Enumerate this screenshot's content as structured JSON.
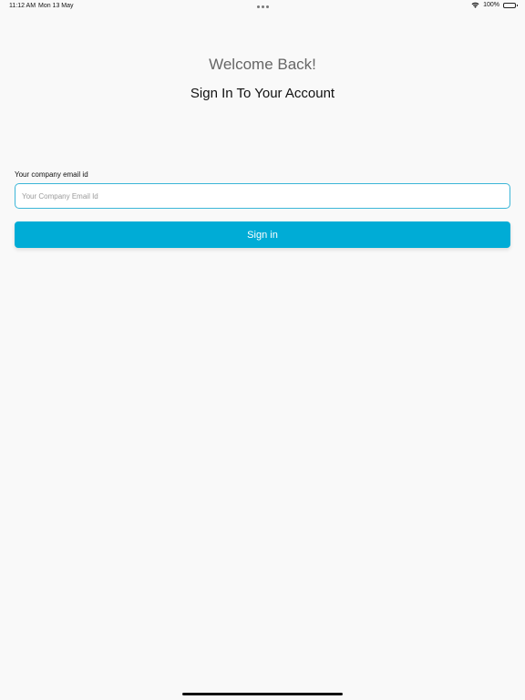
{
  "status_bar": {
    "time": "11:12 AM",
    "date": "Mon 13 May",
    "battery": "100%"
  },
  "screen": {
    "welcome": "Welcome Back!",
    "headline": "Sign In To Your Account"
  },
  "form": {
    "email_label": "Your company email id",
    "email_value": "",
    "email_placeholder": "Your Company Email Id",
    "signin_label": "Sign in"
  },
  "colors": {
    "accent": "#00acd6",
    "input_border": "#3bb6d8",
    "background": "#f9f9f9"
  },
  "icons": [
    "wifi-icon",
    "battery-icon",
    "more-dots-icon"
  ]
}
